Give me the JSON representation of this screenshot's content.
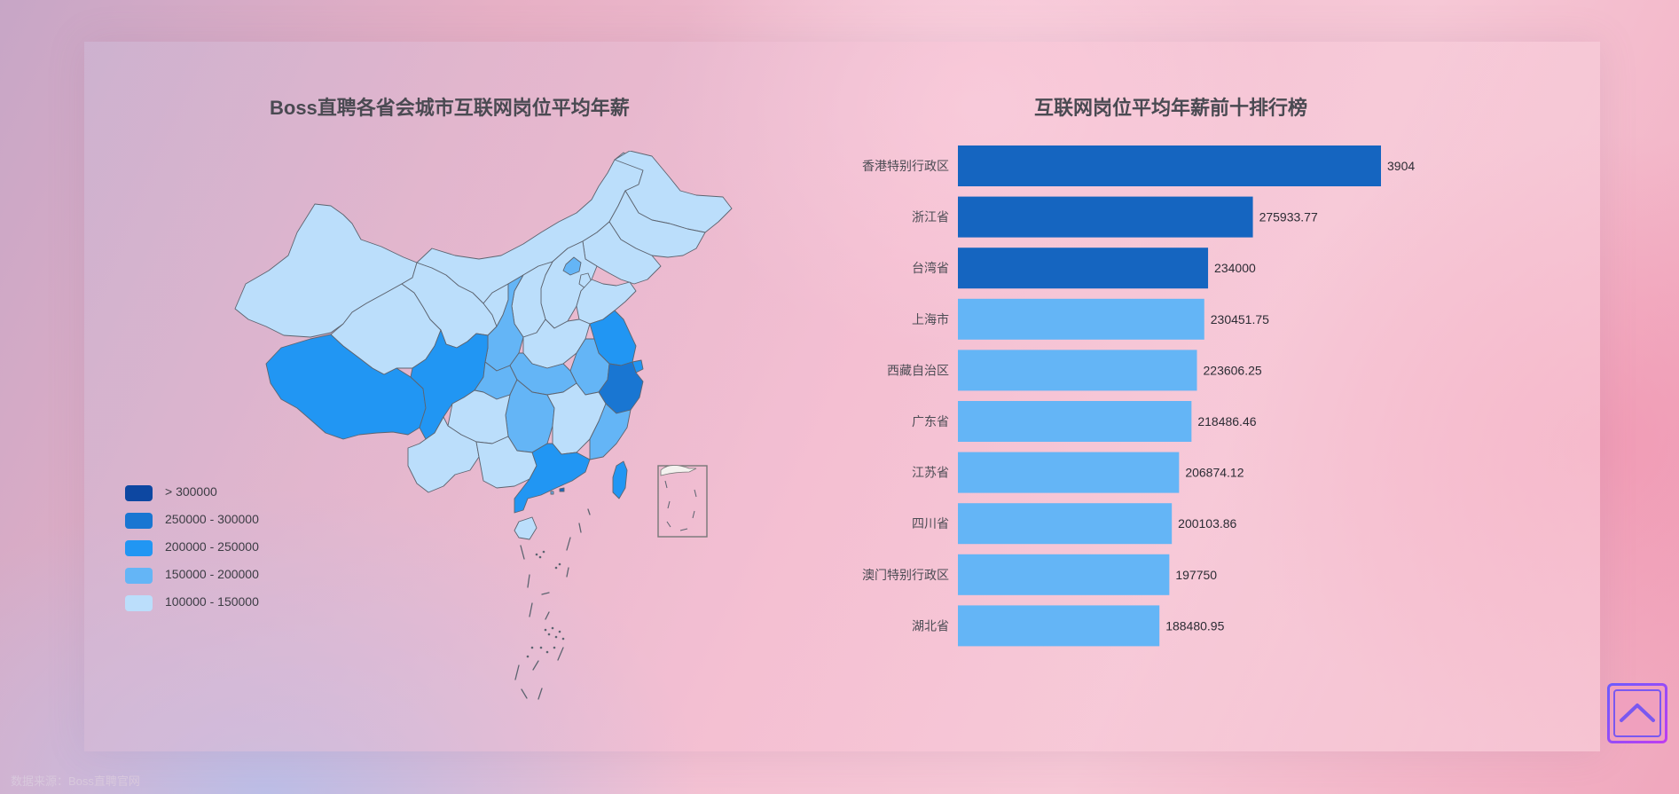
{
  "map": {
    "title": "Boss直聘各省会城市互联网岗位平均年薪",
    "legend": [
      {
        "label": "> 300000",
        "color": "#0d47a1"
      },
      {
        "label": "250000 - 300000",
        "color": "#1976d2"
      },
      {
        "label": "200000 - 250000",
        "color": "#2196f3"
      },
      {
        "label": "150000 - 200000",
        "color": "#64b5f6"
      },
      {
        "label": "100000 - 150000",
        "color": "#bbdefb"
      }
    ]
  },
  "chart_data": {
    "type": "bar",
    "orientation": "horizontal",
    "title": "互联网岗位平均年薪前十排行榜",
    "categories": [
      "香港特别行政区",
      "浙江省",
      "台湾省",
      "上海市",
      "西藏自治区",
      "广东省",
      "江苏省",
      "四川省",
      "澳门特别行政区",
      "湖北省"
    ],
    "values": [
      3904,
      275933.77,
      234000,
      230451.75,
      223606.25,
      218486.46,
      206874.12,
      200103.86,
      197750,
      188480.95
    ],
    "value_labels": [
      "3904",
      "275933.77",
      "234000",
      "230451.75",
      "223606.25",
      "218486.46",
      "206874.12",
      "200103.86",
      "197750",
      "188480.95"
    ],
    "bar_lengths": [
      1,
      0.6972,
      0.5913,
      0.5823,
      0.565,
      0.5521,
      0.5227,
      0.5056,
      0.4997,
      0.4763
    ],
    "colors": [
      "#1565c0",
      "#1565c0",
      "#1565c0",
      "#64b5f6",
      "#64b5f6",
      "#64b5f6",
      "#64b5f6",
      "#64b5f6",
      "#64b5f6",
      "#64b5f6"
    ],
    "grid": false,
    "xaxis_visible": false
  },
  "footer": {
    "source": "数据来源：Boss直聘官网"
  },
  "icons": {
    "back_to_top": "chevron-up-icon"
  }
}
